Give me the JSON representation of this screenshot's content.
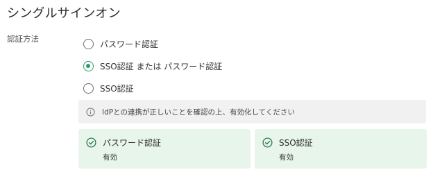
{
  "page": {
    "title": "シングルサインオン"
  },
  "auth_method": {
    "label": "認証方法",
    "options": [
      {
        "label": "パスワード認証",
        "selected": false
      },
      {
        "label": "SSO認証 または パスワード認証",
        "selected": true
      },
      {
        "label": "SSO認証",
        "selected": false
      }
    ]
  },
  "info": {
    "icon": "info-icon",
    "text": "IdPとの連携が正しいことを確認の上、有効化してください"
  },
  "status_cards": [
    {
      "icon": "check-circle-icon",
      "title": "パスワード認証",
      "status": "有効"
    },
    {
      "icon": "check-circle-icon",
      "title": "SSO認証",
      "status": "有効"
    }
  ],
  "colors": {
    "accent": "#2f9e69",
    "card_bg": "#e8f5ea",
    "info_bg": "#f1f1f1"
  }
}
